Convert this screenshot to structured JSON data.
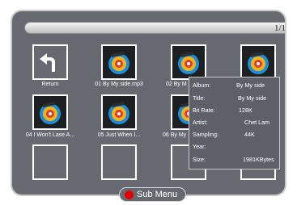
{
  "pager": {
    "page_indicator": "1/1"
  },
  "grid": {
    "return_label": "Return",
    "files": [
      {
        "label": "01 By My side.mp3"
      },
      {
        "label": "02 By M"
      },
      {
        "label": ""
      },
      {
        "label": "04 I Won't Lase A..."
      },
      {
        "label": "05 Just When I..."
      },
      {
        "label": "06  By My"
      }
    ]
  },
  "info_panel": {
    "rows": [
      {
        "key": "Album:",
        "value": "By My side"
      },
      {
        "key": "Title:",
        "value": "By My side"
      },
      {
        "key": "Bit Rate:",
        "value": "128K"
      },
      {
        "key": "Artist:",
        "value": "Chet Lam"
      },
      {
        "key": "Sampling:",
        "value": "44K"
      },
      {
        "key": "Year:",
        "value": ""
      },
      {
        "key": "Size:",
        "value": "1981KBytes"
      }
    ]
  },
  "submenu": {
    "label": "Sub Menu"
  },
  "icons": {
    "return": "return-arrow-icon",
    "music_file": "music-file-icon"
  },
  "colors": {
    "background": "#666a70",
    "accent": "#e30000",
    "border": "#ffffff"
  }
}
